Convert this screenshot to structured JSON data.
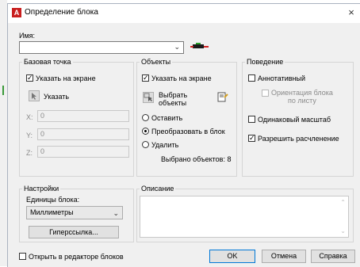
{
  "dialog": {
    "title": "Определение блока",
    "close": "×",
    "app_icon": "A"
  },
  "name": {
    "label": "Имя:",
    "value": ""
  },
  "base_point": {
    "title": "Базовая точка",
    "specify_on_screen": "Указать на экране",
    "pick_button": "Указать",
    "x_label": "X:",
    "x_value": "0",
    "y_label": "Y:",
    "y_value": "0",
    "z_label": "Z:",
    "z_value": "0"
  },
  "objects": {
    "title": "Объекты",
    "specify_on_screen": "Указать на экране",
    "select_objects_line1": "Выбрать",
    "select_objects_line2": "объекты",
    "retain": "Оставить",
    "convert": "Преобразовать в блок",
    "delete": "Удалить",
    "selected_count": "Выбрано объектов: 8"
  },
  "behavior": {
    "title": "Поведение",
    "annotative": "Аннотативный",
    "match_orientation_line1": "Ориентация блока",
    "match_orientation_line2": "по листу",
    "uniform_scale": "Одинаковый масштаб",
    "allow_explode": "Разрешить расчленение"
  },
  "settings": {
    "title": "Настройки",
    "units_label": "Единицы блока:",
    "units_value": "Миллиметры",
    "hyperlink_button": "Гиперссылка..."
  },
  "description": {
    "title": "Описание",
    "value": ""
  },
  "footer": {
    "open_in_editor": "Открыть в редакторе блоков",
    "ok": "OK",
    "cancel": "Отмена",
    "help": "Справка"
  },
  "checks": {
    "specify_base": true,
    "specify_objects": true,
    "annotative": false,
    "match_orientation": false,
    "uniform_scale": false,
    "allow_explode": true,
    "open_in_editor": false
  },
  "colors": {
    "accent": "#0078d7",
    "app_icon_bg": "#c81e1e"
  }
}
